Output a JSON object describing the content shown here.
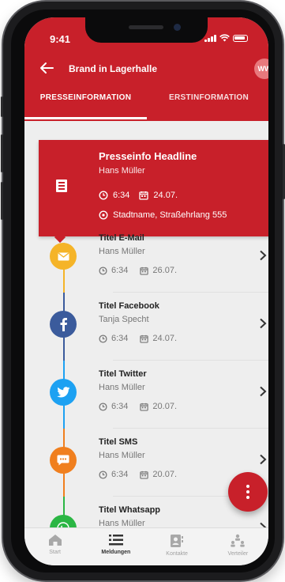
{
  "status_bar": {
    "time": "9:41"
  },
  "header": {
    "title": "Brand in Lagerhalle",
    "avatar_initials": "WW"
  },
  "tabs": [
    {
      "label": "PRESSEINFORMATION",
      "active": true
    },
    {
      "label": "ERSTINFORMATION",
      "active": false
    }
  ],
  "featured": {
    "headline": "Presseinfo Headline",
    "author": "Hans Müller",
    "time": "6:34",
    "date": "24.07.",
    "location": "Stadtname, Straßehrlang 555"
  },
  "messages": [
    {
      "title": "Titel E-Mail",
      "author": "Hans Müller",
      "time": "6:34",
      "date": "26.07.",
      "icon": "email-icon",
      "color": "#f5b428"
    },
    {
      "title": "Titel Facebook",
      "author": "Tanja Specht",
      "time": "6:34",
      "date": "24.07.",
      "icon": "facebook-icon",
      "color": "#3b5b9c"
    },
    {
      "title": "Titel Twitter",
      "author": "Hans Müller",
      "time": "6:34",
      "date": "20.07.",
      "icon": "twitter-icon",
      "color": "#1da1f2"
    },
    {
      "title": "Titel SMS",
      "author": "Hans Müller",
      "time": "6:34",
      "date": "20.07.",
      "icon": "sms-icon",
      "color": "#f07f1e"
    },
    {
      "title": "Titel Whatsapp",
      "author": "Hans Müller",
      "time": "",
      "date": "",
      "icon": "whatsapp-icon",
      "color": "#2bb644"
    }
  ],
  "bottom_nav": [
    {
      "label": "Start",
      "icon": "home-icon",
      "active": false
    },
    {
      "label": "Meldungen",
      "icon": "list-icon",
      "active": true
    },
    {
      "label": "Kontakte",
      "icon": "contacts-icon",
      "active": false
    },
    {
      "label": "Verteiler",
      "icon": "hierarchy-icon",
      "active": false
    }
  ],
  "colors": {
    "brand": "#c8202a",
    "background": "#eeeeee"
  }
}
